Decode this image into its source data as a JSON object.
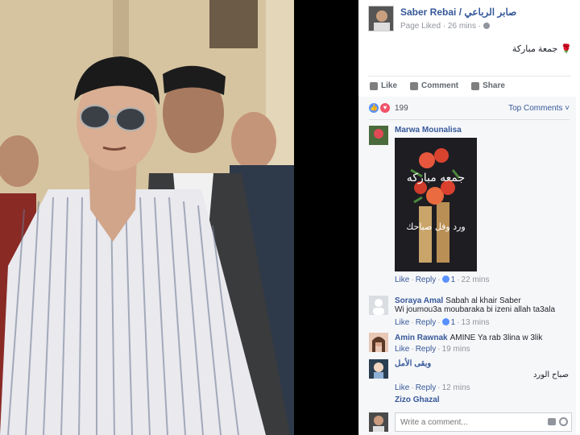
{
  "post": {
    "page_name": "Saber Rebai / صابر الرباعي",
    "meta": "Page Liked · 26 mins ·",
    "text": "جمعة مباركة",
    "actions": {
      "like": "Like",
      "comment": "Comment",
      "share": "Share"
    }
  },
  "reactions": {
    "count": "199",
    "top_comments": "Top Comments ˅"
  },
  "comments": [
    {
      "name": "Marwa Mounalisa",
      "text": "",
      "image_text_1": "جمعه مباركه",
      "image_text_2": "ورد وفل صباحك",
      "like": "Like",
      "reply": "Reply",
      "likes": "1",
      "time": "22 mins"
    },
    {
      "name": "Soraya Amal",
      "text": "Sabah al khair Saber",
      "text2": "Wi joumou3a moubaraka bi izeni allah ta3ala",
      "like": "Like",
      "reply": "Reply",
      "likes": "1",
      "time": "13 mins"
    },
    {
      "name": "Amin Rawnak",
      "text": "AMINE Ya rab 3lina w 3lik",
      "like": "Like",
      "reply": "Reply",
      "time": "19 mins"
    },
    {
      "name": "وبقى الأمل",
      "text": "صباح الورد",
      "like": "Like",
      "reply": "Reply",
      "time": "12 mins"
    },
    {
      "name": "Zizo Ghazal"
    }
  ],
  "composer": {
    "placeholder": "Write a comment..."
  },
  "colors": {
    "link": "#365899",
    "meta": "#90949c",
    "like_blue": "#5890ff",
    "love_red": "#f25268"
  },
  "icons": [
    "like-icon",
    "comment-icon",
    "share-icon",
    "globe-icon",
    "camera-icon",
    "emoji-icon"
  ]
}
